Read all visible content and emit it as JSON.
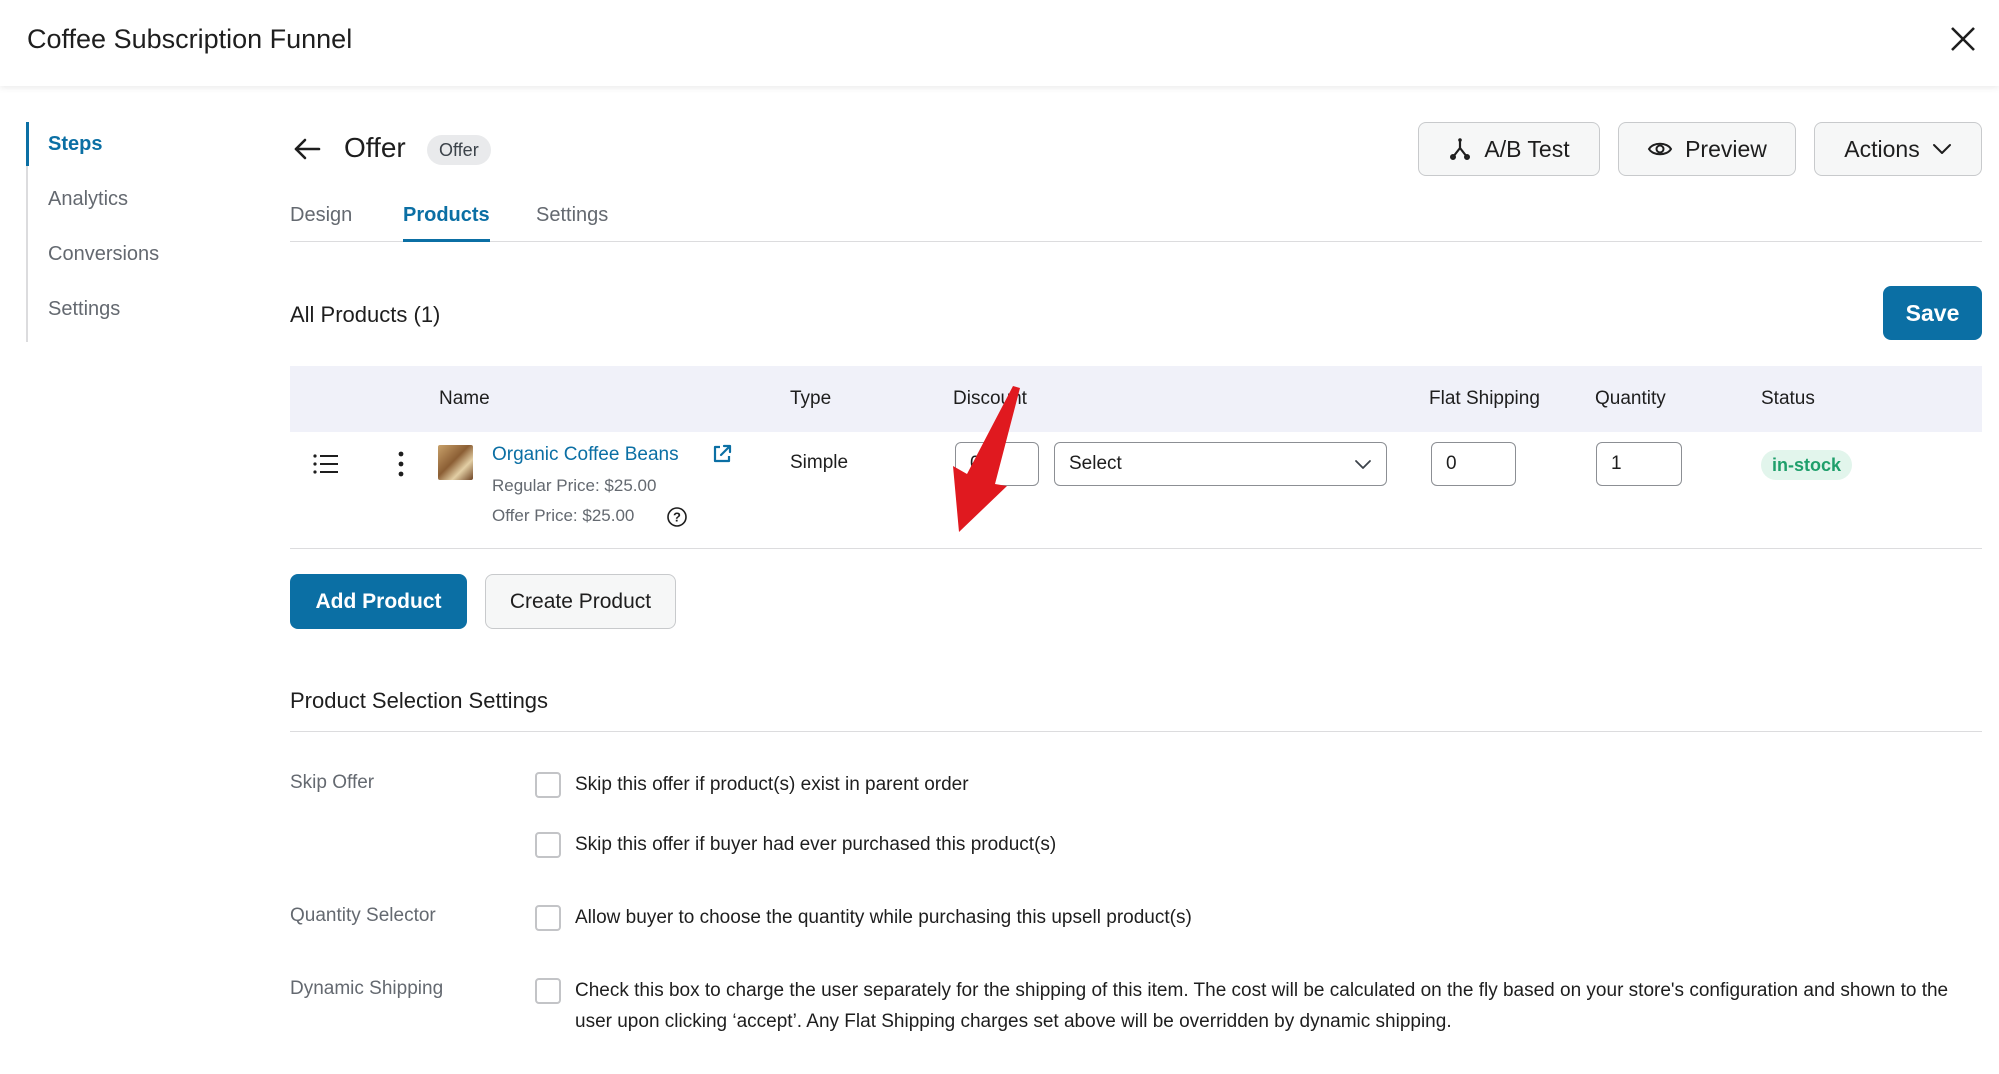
{
  "header": {
    "title": "Coffee Subscription Funnel",
    "close_icon": "close-icon"
  },
  "sidebar": {
    "items": [
      {
        "label": "Steps",
        "active": true
      },
      {
        "label": "Analytics",
        "active": false
      },
      {
        "label": "Conversions",
        "active": false
      },
      {
        "label": "Settings",
        "active": false
      }
    ]
  },
  "step": {
    "title": "Offer",
    "badge": "Offer",
    "buttons": {
      "ab_test": "A/B Test",
      "preview": "Preview",
      "actions": "Actions"
    }
  },
  "tabs": [
    {
      "label": "Design",
      "active": false
    },
    {
      "label": "Products",
      "active": true
    },
    {
      "label": "Settings",
      "active": false
    }
  ],
  "products": {
    "heading": "All Products (1)",
    "save_label": "Save",
    "columns": {
      "name": "Name",
      "type": "Type",
      "discount": "Discount",
      "flat_shipping": "Flat Shipping",
      "quantity": "Quantity",
      "status": "Status"
    },
    "rows": [
      {
        "name": "Organic Coffee Beans",
        "regular_price": "Regular Price: $25.00",
        "offer_price": "Offer Price: $25.00",
        "type": "Simple",
        "discount_value": "0",
        "discount_type": "Select",
        "flat_shipping": "0",
        "quantity": "1",
        "status": "in-stock"
      }
    ],
    "add_label": "Add Product",
    "create_label": "Create Product"
  },
  "selection_settings": {
    "title": "Product Selection Settings",
    "skip_offer": {
      "label": "Skip Offer",
      "options": [
        {
          "text": "Skip this offer if product(s) exist in parent order",
          "checked": false
        },
        {
          "text": "Skip this offer if buyer had ever purchased this product(s)",
          "checked": false
        }
      ]
    },
    "quantity_selector": {
      "label": "Quantity Selector",
      "options": [
        {
          "text": "Allow buyer to choose the quantity while purchasing this upsell product(s)",
          "checked": false
        }
      ]
    },
    "dynamic_shipping": {
      "label": "Dynamic Shipping",
      "options": [
        {
          "text": "Check this box to charge the user separately for the shipping of this item. The cost will be calculated on the fly based on your store's configuration and shown to the user upon clicking ‘accept’. Any Flat Shipping charges set above will be overridden by dynamic shipping.",
          "checked": false
        }
      ]
    }
  },
  "colors": {
    "accent": "#0b6fa4",
    "stock_bg": "#e2f5ec",
    "stock_text": "#1f9f6b",
    "annotation_arrow": "#e0191f"
  }
}
